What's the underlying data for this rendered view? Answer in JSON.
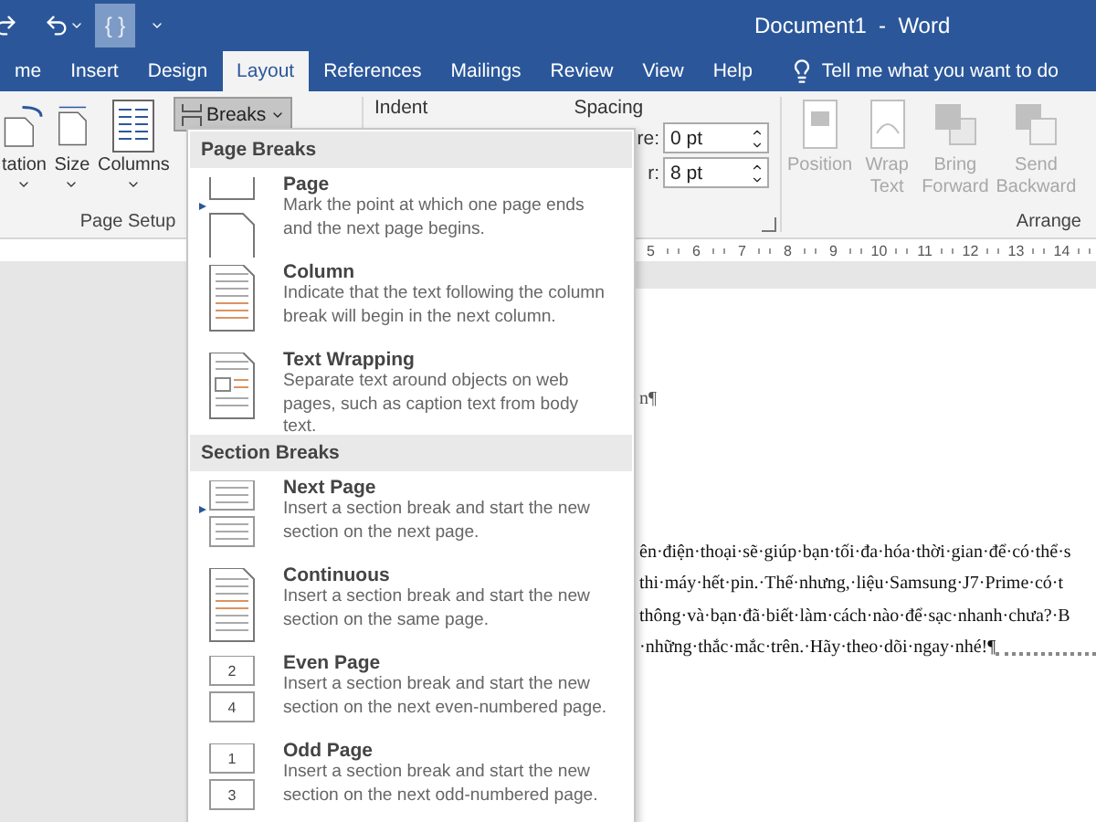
{
  "title_bar": {
    "title": "Document1  -  Word",
    "quick_access_button": "{ }"
  },
  "tabs": [
    {
      "label": "me",
      "selected": false
    },
    {
      "label": "Insert",
      "selected": false
    },
    {
      "label": "Design",
      "selected": false
    },
    {
      "label": "Layout",
      "selected": true
    },
    {
      "label": "References",
      "selected": false
    },
    {
      "label": "Mailings",
      "selected": false
    },
    {
      "label": "Review",
      "selected": false
    },
    {
      "label": "View",
      "selected": false
    },
    {
      "label": "Help",
      "selected": false
    }
  ],
  "tell_me": "Tell me what you want to do",
  "ribbon": {
    "page_setup": {
      "buttons": [
        {
          "kind": "orientation",
          "label": "tation"
        },
        {
          "kind": "size",
          "label": "Size"
        },
        {
          "kind": "columns",
          "label": "Columns"
        }
      ],
      "breaks_button": "Breaks",
      "label": "Page Setup"
    },
    "paragraph": {
      "indent": "Indent",
      "spacing": "Spacing",
      "fields": [
        {
          "label": "re:",
          "value": "0 pt"
        },
        {
          "label": "r:",
          "value": "8 pt"
        }
      ]
    },
    "arrange": {
      "buttons": [
        {
          "kind": "position",
          "lines": [
            "Position"
          ],
          "disabled": true
        },
        {
          "kind": "wrap",
          "lines": [
            "Wrap",
            "Text"
          ],
          "disabled": true
        },
        {
          "kind": "forward",
          "lines": [
            "Bring",
            "Forward"
          ],
          "disabled": true
        },
        {
          "kind": "backward",
          "lines": [
            "Send",
            "Backward"
          ],
          "disabled": true
        }
      ],
      "label": "Arrange"
    }
  },
  "ruler": [
    "5",
    "6",
    "7",
    "8",
    "9",
    "10",
    "11",
    "12",
    "13",
    "14"
  ],
  "breaks_menu": [
    {
      "heading": "Page Breaks",
      "items": [
        {
          "kind": "page",
          "title": "Page",
          "description": "Mark the point at which one page ends and the next page begins."
        },
        {
          "kind": "column",
          "title": "Column",
          "description": "Indicate that the text following the column break will begin in the next column."
        },
        {
          "kind": "text-wrapping",
          "title": "Text Wrapping",
          "description": "Separate text around objects on web pages, such as caption text from body text."
        }
      ]
    },
    {
      "heading": "Section Breaks",
      "items": [
        {
          "kind": "next-page",
          "title": "Next Page",
          "description": "Insert a section break and start the new section on the next page."
        },
        {
          "kind": "continuous",
          "title": "Continuous",
          "description": "Insert a section break and start the new section on the same page."
        },
        {
          "kind": "even-page",
          "title": "Even Page",
          "description": "Insert a section break and start the new section on the next even-numbered page.",
          "icon_digits": [
            "2",
            "4"
          ]
        },
        {
          "kind": "odd-page",
          "title": "Odd Page",
          "description": "Insert a section break and start the new section on the next odd-numbered page.",
          "icon_digits": [
            "1",
            "3"
          ]
        }
      ]
    }
  ],
  "document": {
    "heading_fragment": "n¶",
    "lines": [
      "ên·điện·thoại·sẽ·giúp·bạn·tối·đa·hóa·thời·gian·để·có·thể·s",
      "thi·máy·hết·pin.·Thế·nhưng,·liệu·Samsung·J7·Prime·có·t",
      "thông·và·bạn·đã·biết·làm·cách·nào·để·sạc·nhanh·chưa?·B",
      "·những·thắc·mắc·trên.·Hãy·theo·dõi·ngay·nhé!¶"
    ]
  }
}
